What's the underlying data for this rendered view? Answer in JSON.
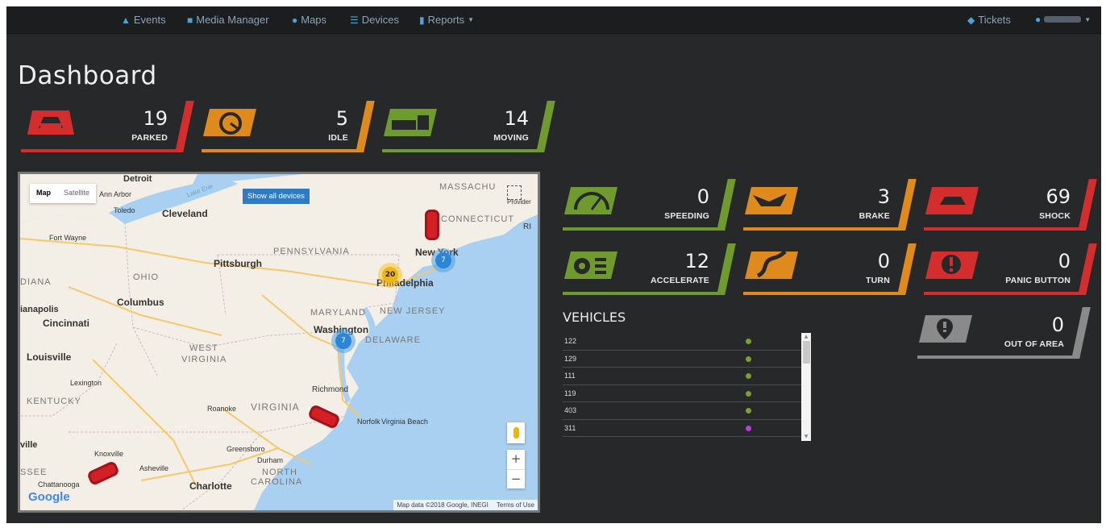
{
  "nav": {
    "events": "Events",
    "media_manager": "Media Manager",
    "maps": "Maps",
    "devices": "Devices",
    "reports": "Reports",
    "tickets": "Tickets"
  },
  "page_title": "Dashboard",
  "status_cards": [
    {
      "count": "19",
      "label": "PARKED",
      "color": "#d42d2d",
      "icon": "parked-car-icon"
    },
    {
      "count": "5",
      "label": "IDLE",
      "color": "#de8a1c",
      "icon": "idle-gauge-icon"
    },
    {
      "count": "14",
      "label": "MOVING",
      "color": "#6e9a2e",
      "icon": "moving-truck-icon"
    }
  ],
  "event_cards": [
    {
      "count": "0",
      "label": "SPEEDING",
      "color": "#6e9a2e",
      "icon": "speedometer-icon"
    },
    {
      "count": "3",
      "label": "BRAKE",
      "color": "#de8a1c",
      "icon": "brake-icon"
    },
    {
      "count": "69",
      "label": "SHOCK",
      "color": "#d42d2d",
      "icon": "shock-icon"
    },
    {
      "count": "12",
      "label": "ACCELERATE",
      "color": "#6e9a2e",
      "icon": "accelerate-icon"
    },
    {
      "count": "0",
      "label": "TURN",
      "color": "#de8a1c",
      "icon": "turn-icon"
    },
    {
      "count": "0",
      "label": "PANIC BUTTON",
      "color": "#d42d2d",
      "icon": "panic-icon"
    },
    {
      "count": "0",
      "label": "OUT OF AREA",
      "color": "#8a8a8a",
      "icon": "out-of-area-icon"
    }
  ],
  "map": {
    "type_map": "Map",
    "type_satellite": "Satellite",
    "show_all": "Show all devices",
    "zoom_in": "+",
    "zoom_out": "−",
    "attribution": "Map data ©2018 Google, INEGI",
    "terms": "Terms of Use",
    "google": "Google",
    "cluster_20": "20",
    "cluster_7a": "7",
    "cluster_7b": "7",
    "places": [
      "Detroit",
      "Ann Arbor",
      "Toledo",
      "Cleveland",
      "Fort Wayne",
      "Pittsburgh",
      "PENNSYLVANIA",
      "MASSACHU",
      "Provider",
      "CONNECTICUT",
      "RI",
      "New York",
      "Philadelphia",
      "OHIO",
      "DIANA",
      "Columbus",
      "ianapolis",
      "Cincinnati",
      "MARYLAND",
      "NEW JERSEY",
      "Washington",
      "DELAWARE",
      "WEST",
      "VIRGINIA",
      "Louisville",
      "Lexington",
      "KENTUCKY",
      "Richmond",
      "Roanoke",
      "VIRGINIA",
      "Norfolk",
      "Virginia Beach",
      "ville",
      "Knoxville",
      "Greensboro",
      "Durham",
      "SSEE",
      "Asheville",
      "NORTH",
      "CAROLINA",
      "Charlotte",
      "Chattanooga",
      "Lake Erie"
    ]
  },
  "vehicles": {
    "title": "VEHICLES",
    "rows": [
      {
        "id": "122",
        "status_color": "#7aa12e"
      },
      {
        "id": "129",
        "status_color": "#7aa12e"
      },
      {
        "id": "111",
        "status_color": "#7aa12e"
      },
      {
        "id": "119",
        "status_color": "#7aa12e"
      },
      {
        "id": "403",
        "status_color": "#7aa12e"
      },
      {
        "id": "311",
        "status_color": "#c13ae0"
      }
    ]
  }
}
